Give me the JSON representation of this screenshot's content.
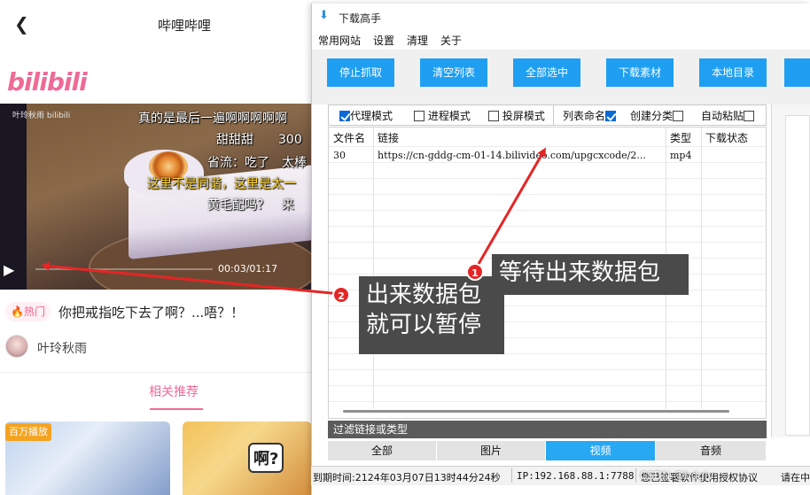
{
  "mobile": {
    "header_title": "哔哩哔哩",
    "logo": "bilibili",
    "video": {
      "watermark": "叶玲秋雨 bilibili",
      "subtitles": [
        "真的是最后一遍啊啊啊啊啊",
        "甜甜甜　　300",
        "省流：吃了　太棒",
        "这里不是同谐，这里是太一",
        "黄毛配吗？　来"
      ],
      "time": "00:03/01:17"
    },
    "hot_badge": "热门",
    "video_title": "你把戒指吃下去了啊？...唔？！",
    "author": "叶玲秋雨",
    "tab": "相关推荐",
    "thumb1_badge": "百万播放",
    "thumb2_text": "啊?"
  },
  "window": {
    "title": "下载高手",
    "menu": [
      "常用网站",
      "设置",
      "清理",
      "关于"
    ],
    "buttons": [
      "停止抓取",
      "清空列表",
      "全部选中",
      "下载素材",
      "本地目录"
    ],
    "options": {
      "proxy": "代理模式",
      "process": "进程模式",
      "screen": "投屏模式",
      "list_name": "列表命名",
      "create_cat": "创建分类",
      "auto_paste": "自动粘贴"
    },
    "table": {
      "headers": [
        "文件名",
        "链接",
        "类型",
        "下载状态"
      ],
      "rows": [
        {
          "name": "30",
          "link": "https://cn-gddg-cm-01-14.bilivideo.com/upgcxcode/2...",
          "type": "mp4",
          "status": ""
        }
      ]
    },
    "filter_label": "过滤链接或类型",
    "filter_tabs": [
      "全部",
      "图片",
      "视频",
      "音频"
    ],
    "status": {
      "expire": "到期时间:2124年03月07日13时44分24秒",
      "ip": "IP:192.168.88.1:7788",
      "agreement": "您已签署软件使用授权协议",
      "state": "请在中"
    }
  },
  "annotations": {
    "callout1": "等待出来数据包",
    "callout2_line1": "出来数据包",
    "callout2_line2": "就可以暂停",
    "num1": "1",
    "num2": "2",
    "watermark": "CSDN @bdgiv"
  },
  "colors": {
    "bili_pink": "#f06a96",
    "button_blue": "#1e9ff2",
    "active_tab": "#27a8f3",
    "arrow_red": "#e62525"
  }
}
